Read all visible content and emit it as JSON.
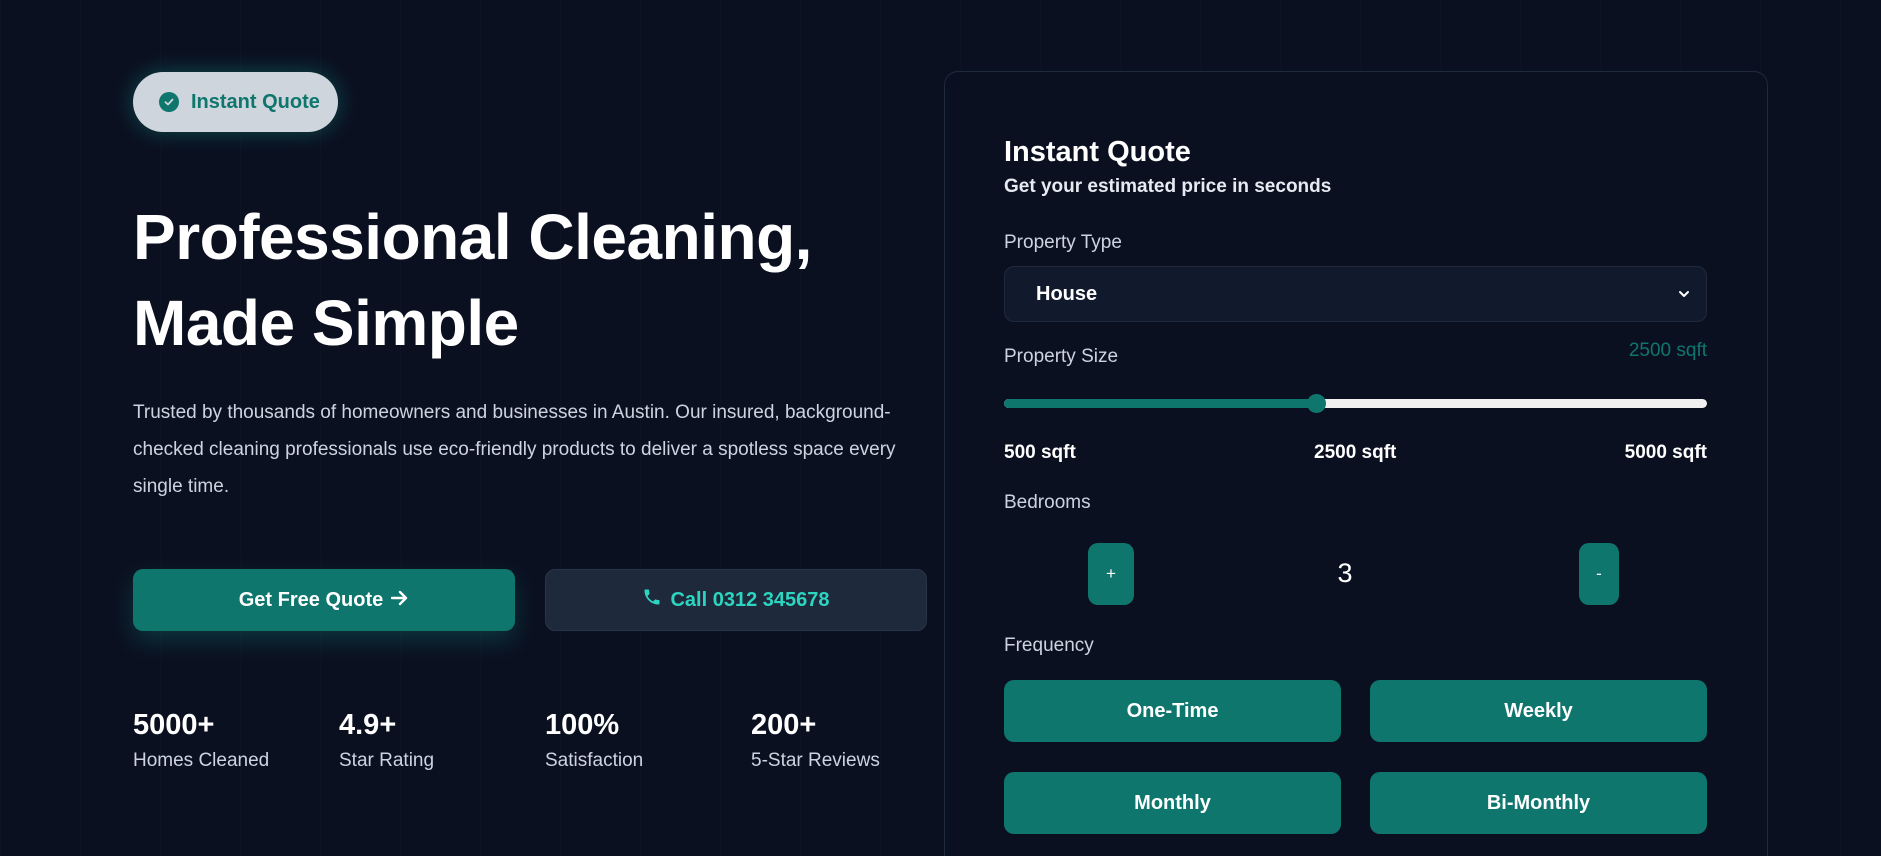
{
  "hero": {
    "badge": {
      "label": "Instant Quote",
      "icon": "check-circle-icon"
    },
    "headline_line1": "Professional Cleaning,",
    "headline_line2": "Made Simple",
    "description": "Trusted by thousands of homeowners and businesses in Austin. Our insured, background-checked cleaning professionals use eco-friendly products to deliver a spotless space every single time.",
    "primary_cta": {
      "label": "Get Free Quote",
      "icon": "arrow-right-icon"
    },
    "secondary_cta": {
      "label": "Call 0312 345678",
      "icon": "phone-icon"
    },
    "stats": [
      {
        "value": "5000+",
        "label": "Homes Cleaned"
      },
      {
        "value": "4.9+",
        "label": "Star Rating"
      },
      {
        "value": "100%",
        "label": "Satisfaction"
      },
      {
        "value": "200+",
        "label": "5-Star Reviews"
      }
    ]
  },
  "quote": {
    "title": "Instant Quote",
    "subtitle": "Get your estimated price in seconds",
    "property_type": {
      "label": "Property Type",
      "selected": "House"
    },
    "property_size": {
      "label": "Property Size",
      "current_display": "2500 sqft",
      "min": 500,
      "max": 5000,
      "value": 2500,
      "tick_min": "500 sqft",
      "tick_mid": "2500 sqft",
      "tick_max": "5000 sqft"
    },
    "bedrooms": {
      "label": "Bedrooms",
      "plus": "+",
      "minus": "-",
      "value": "3"
    },
    "frequency": {
      "label": "Frequency",
      "options": [
        "One-Time",
        "Weekly",
        "Monthly",
        "Bi-Monthly"
      ]
    }
  },
  "colors": {
    "background": "#0b1020",
    "accent": "#0f766e",
    "accent_text": "#2dd4bf",
    "badge_bg": "#cfd5dc"
  }
}
